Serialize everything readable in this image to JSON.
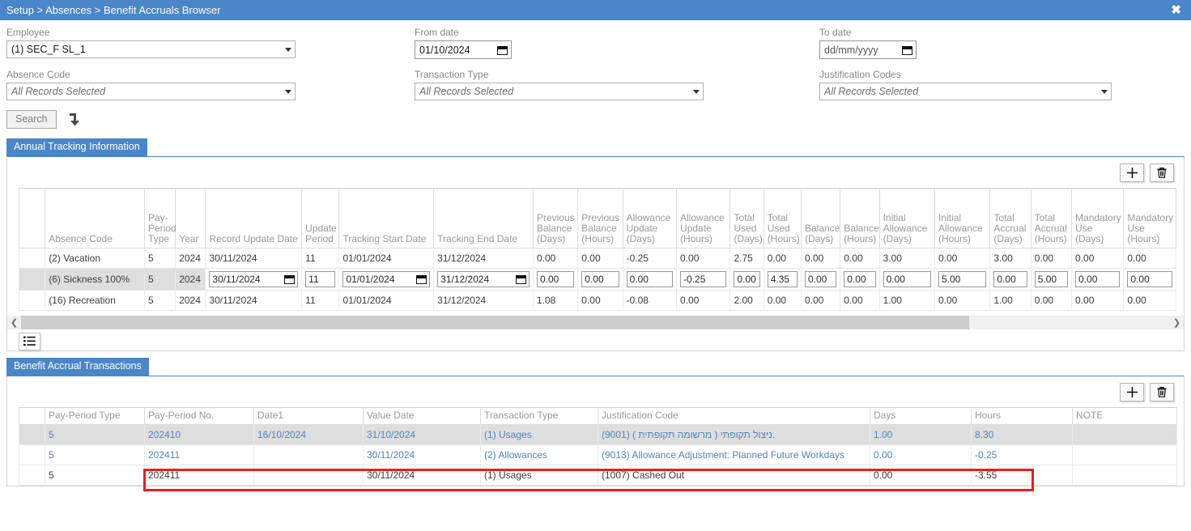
{
  "titlebar": {
    "breadcrumb": "Setup > Absences > Benefit Accruals Browser",
    "close_label": "✖"
  },
  "search_form": {
    "employee": {
      "label": "Employee",
      "value": "(1) SEC_F SL_1"
    },
    "from_date": {
      "label": "From date",
      "value": "01/10/2024"
    },
    "to_date": {
      "label": "To date",
      "value": "dd/mm/yyyy"
    },
    "absence_code": {
      "label": "Absence Code",
      "value": "All Records Selected"
    },
    "transaction_type": {
      "label": "Transaction Type",
      "value": "All Records Selected"
    },
    "justification_codes": {
      "label": "Justification Codes",
      "value": "All Records Selected"
    },
    "search_button": "Search",
    "flow_icon": "flow-arrow-icon"
  },
  "annual_panel": {
    "tab_label": "Annual Tracking Information",
    "add_button": "+",
    "delete_button": "trash",
    "columns": [
      "",
      "Absence Code",
      "Pay-Period Type",
      "Year",
      "Record Update Date",
      "Update Period",
      "Tracking Start Date",
      "Tracking End Date",
      "Previous Balance (Days)",
      "Previous Balance (Hours)",
      "Allowance Update (Days)",
      "Allowance Update (Hours)",
      "Total Used (Days)",
      "Total Used (Hours)",
      "Balance (Days)",
      "Balance (Hours)",
      "Initial Allowance (Days)",
      "Initial Allowance (Hours)",
      "Total Accrual (Days)",
      "Total Accrual (Hours)",
      "Mandatory Use (Days)",
      "Mandatory Use (Hours)"
    ],
    "rows": [
      {
        "selected": false,
        "editing": false,
        "cells": [
          "(2) Vacation",
          "5",
          "2024",
          "30/11/2024",
          "11",
          "01/01/2024",
          "31/12/2024",
          "0.00",
          "0.00",
          "-0.25",
          "0.00",
          "2.75",
          "0.00",
          "0.00",
          "0.00",
          "3.00",
          "0.00",
          "3.00",
          "0.00",
          "0.00",
          "0.00"
        ]
      },
      {
        "selected": true,
        "editing": true,
        "highlight_index": 14,
        "cells": [
          "(6) Sickness 100%",
          "5",
          "2024",
          "30/11/2024",
          "11",
          "01/01/2024",
          "31/12/2024",
          "0.00",
          "0.00",
          "0.00",
          "-0.25",
          "0.00",
          "4.35",
          "0.00",
          "0.00",
          "0.00",
          "5.00",
          "0.00",
          "5.00",
          "0.00",
          "0.00"
        ]
      },
      {
        "selected": false,
        "editing": false,
        "cells": [
          "(16) Recreation",
          "5",
          "2024",
          "30/11/2024",
          "11",
          "01/01/2024",
          "31/12/2024",
          "1.08",
          "0.00",
          "-0.08",
          "0.00",
          "2.00",
          "0.00",
          "0.00",
          "0.00",
          "1.00",
          "0.00",
          "1.00",
          "0.00",
          "0.00",
          "0.00"
        ]
      }
    ],
    "scroll_left_arrow": "❮",
    "scroll_right_arrow": "❯",
    "list_icon": "list-view-icon"
  },
  "transactions_panel": {
    "tab_label": "Benefit Accrual Transactions",
    "add_button": "+",
    "delete_button": "trash",
    "columns": [
      "",
      "Pay-Period Type",
      "Pay-Period No.",
      "Date1",
      "Value Date",
      "Transaction Type",
      "Justification Code",
      "Days",
      "Hours",
      "NOTE"
    ],
    "rows": [
      {
        "selected": true,
        "link_style": true,
        "highlight": false,
        "cells": [
          "5",
          "202410",
          "16/10/2024",
          "31/10/2024",
          "(1) Usages",
          "(9001) ( מרשומה תקופתית ) ניצול תקופתי.",
          "1.00",
          "8.30",
          ""
        ]
      },
      {
        "selected": false,
        "link_style": true,
        "highlight": false,
        "cells": [
          "5",
          "202411",
          "",
          "30/11/2024",
          "(2) Allowances",
          "(9013) Allowance Adjustment: Planned Future Workdays",
          "0.00",
          "-0.25",
          ""
        ]
      },
      {
        "selected": false,
        "link_style": false,
        "highlight": true,
        "cells": [
          "5",
          "202411",
          "",
          "30/11/2024",
          "(1) Usages",
          "(1007) Cashed Out",
          "0.00",
          "-3.55",
          ""
        ]
      }
    ]
  },
  "colors": {
    "accent_blue": "#4a86c8",
    "highlight_red": "#ee1c1c",
    "selected_row": "#dedede"
  }
}
